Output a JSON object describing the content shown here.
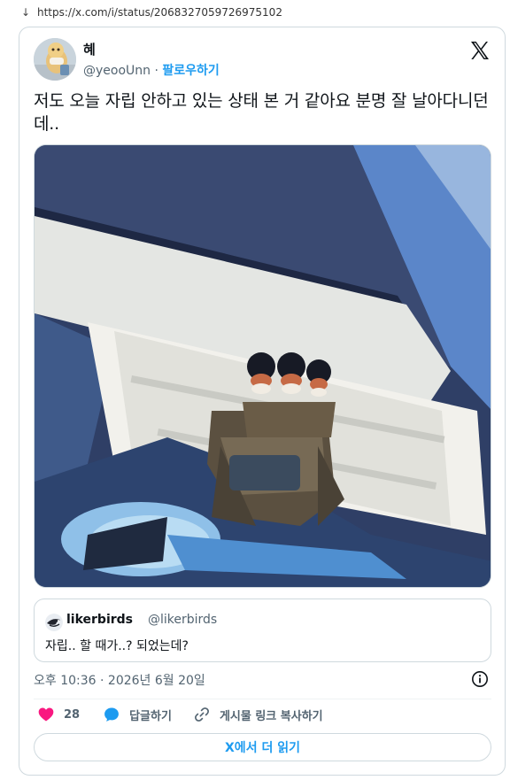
{
  "browser": {
    "download_icon": "down-arrow",
    "url": "https://x.com/i/status/2068327059726975102"
  },
  "tweet": {
    "author_name": "혜",
    "author_handle": "@yeooUnn",
    "separator": " · ",
    "follow_label": "팔로우하기",
    "text": "저도 오늘 자립 안하고 있는 상태 본 거 같아요 분명 잘 날아다니던데..",
    "timestamp": "오후 10:36 · 2026년 6월 20일",
    "brand_icon": "x-logo"
  },
  "quote": {
    "name": "likerbirds",
    "handle": "@likerbirds",
    "text": "자립.. 할 때가..? 되었는데?"
  },
  "actions": {
    "like_count": "28",
    "reply_label": "답글하기",
    "copy_link_label": "게시물 링크 복사하기"
  },
  "read_more_label": "X에서 더 읽기",
  "colors": {
    "accent": "#1d9bf0",
    "like": "#f91880",
    "text": "#0f1419",
    "muted": "#536471",
    "border": "#cfd9de"
  }
}
